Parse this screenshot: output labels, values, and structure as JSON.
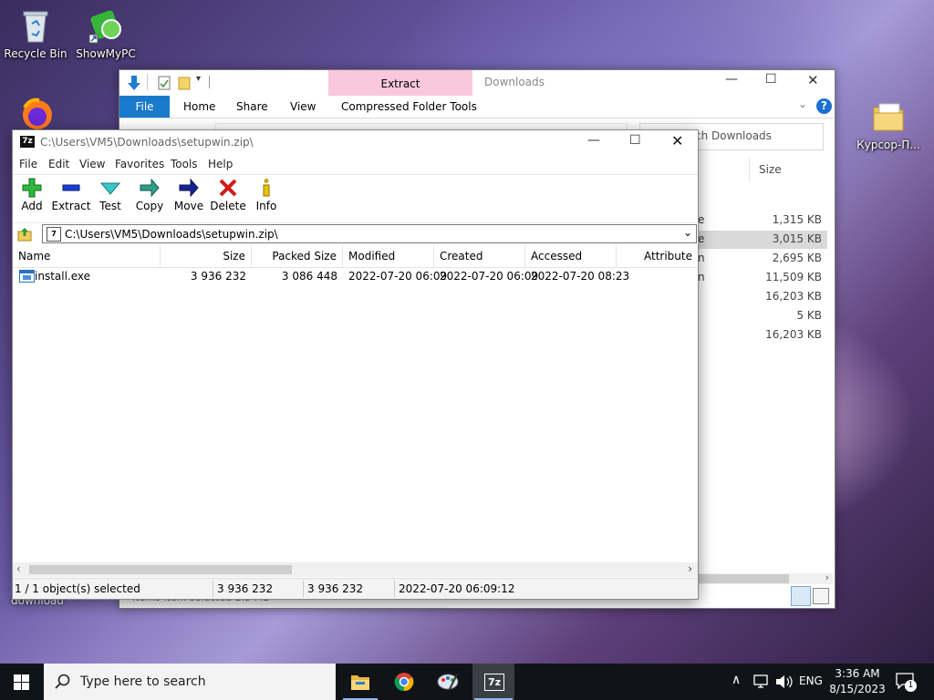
{
  "desktop": {
    "icons": [
      {
        "label": "Recycle Bin"
      },
      {
        "label": "ShowMyPC"
      },
      {
        "label": "Курсор-П..."
      }
    ],
    "partial_label": "download"
  },
  "explorer": {
    "title": "Downloads",
    "context_tab": "Extract",
    "tabs": [
      "File",
      "Home",
      "Share",
      "View",
      "Compressed Folder Tools"
    ],
    "search_placeholder": "ch Downloads",
    "column_size": "Size",
    "rows": [
      {
        "frag": "e",
        "size": "1,315 KB"
      },
      {
        "frag": "e",
        "size": "3,015 KB"
      },
      {
        "frag": "n",
        "size": "2,695 KB"
      },
      {
        "frag": "n",
        "size": "11,509 KB"
      },
      {
        "frag": "",
        "size": "16,203 KB"
      },
      {
        "frag": "",
        "size": "5 KB"
      },
      {
        "frag": "",
        "size": "16,203 KB"
      }
    ],
    "status_partial": "Items   Item selected  2.5 MB"
  },
  "sevenzip": {
    "title": "C:\\Users\\VM5\\Downloads\\setupwin.zip\\",
    "menu": [
      "File",
      "Edit",
      "View",
      "Favorites",
      "Tools",
      "Help"
    ],
    "tools": [
      "Add",
      "Extract",
      "Test",
      "Copy",
      "Move",
      "Delete",
      "Info"
    ],
    "address": "C:\\Users\\VM5\\Downloads\\setupwin.zip\\",
    "columns": [
      "Name",
      "Size",
      "Packed Size",
      "Modified",
      "Created",
      "Accessed",
      "Attribute"
    ],
    "files": [
      {
        "name": "install.exe",
        "size": "3 936 232",
        "packed": "3 086 448",
        "modified": "2022-07-20 06:09",
        "created": "2022-07-20 06:09",
        "accessed": "2022-07-20 08:23"
      }
    ],
    "status": {
      "selected": "1 / 1 object(s) selected",
      "size": "3 936 232",
      "packed": "3 936 232",
      "date": "2022-07-20 06:09:12"
    }
  },
  "taskbar": {
    "search_placeholder": "Type here to search",
    "language": "ENG",
    "time": "3:36 AM",
    "date": "8/15/2023",
    "notification_count": "1"
  },
  "colors": {
    "file_tab": "#1979ca",
    "extract_tab": "#f9c8dc",
    "taskbar": "#101418"
  }
}
